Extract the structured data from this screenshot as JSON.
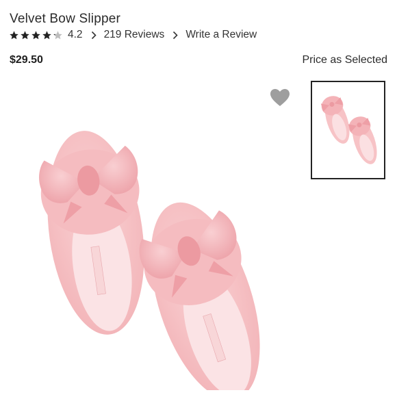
{
  "product": {
    "title": "Velvet Bow Slipper",
    "rating": 4.2,
    "rating_text": "4.2",
    "stars_filled": 4,
    "stars_total": 5,
    "reviews_link": "219 Reviews",
    "write_review_link": "Write a Review",
    "price": "$29.50",
    "price_note": "Price as Selected"
  },
  "icons": {
    "star": "star-icon",
    "chevron": "chevron-right-icon",
    "wishlist": "heart-icon"
  },
  "colors": {
    "slipper_pink": "#f7c3c6",
    "star_filled": "#222222",
    "star_empty": "#bdbdbd",
    "heart": "#9e9e9e",
    "thumb_border": "#222222"
  }
}
